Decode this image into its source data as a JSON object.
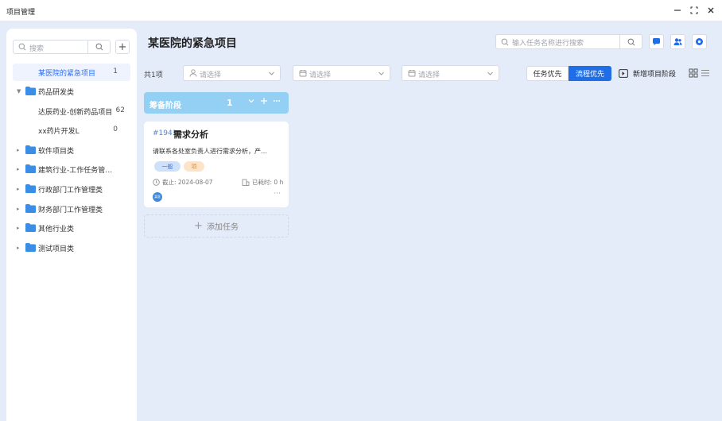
{
  "window": {
    "title": "项目管理",
    "minimize_icon": "minus",
    "maximize_icon": "expand",
    "close_icon": "close"
  },
  "sidebar": {
    "search_placeholder": "搜索",
    "add_label": "+",
    "items": [
      {
        "label": "某医院的紧急项目",
        "count": "1",
        "selected": true,
        "level": 1
      },
      {
        "label": "药品研发类",
        "expanded": true,
        "folder": true
      },
      {
        "label": "达辰药业-创新药品项目",
        "count": "62",
        "level": 1
      },
      {
        "label": "xx药片开发L",
        "count": "0",
        "level": 1
      },
      {
        "label": "软件项目类",
        "folder": true
      },
      {
        "label": "建筑行业-工作任务管…",
        "folder": true
      },
      {
        "label": "行政部门工作管理类",
        "folder": true
      },
      {
        "label": "财务部门工作管理类",
        "folder": true
      },
      {
        "label": "其他行业类",
        "folder": true
      },
      {
        "label": "测试项目类",
        "folder": true
      }
    ]
  },
  "main": {
    "title": "某医院的紧急项目",
    "search_placeholder": "输入任务名称进行搜索",
    "count_label": "共1项",
    "filters": [
      {
        "placeholder": "请选择",
        "icon": "user-icon"
      },
      {
        "placeholder": "请选择",
        "icon": "calendar-icon"
      },
      {
        "placeholder": "请选择",
        "icon": "calendar-icon"
      }
    ],
    "toggle": {
      "task_first": "任务优先",
      "flow_first": "流程优先",
      "active": "flow_first"
    },
    "add_stage_label": "新增项目阶段",
    "accent_color": "#1f6ee8"
  },
  "column": {
    "name": "筹备阶段",
    "count": "1",
    "header_color": "#93d0f3"
  },
  "card": {
    "id": "#1941",
    "title": "需求分析",
    "description": "请联系各处室负责人进行需求分析，产…",
    "tags": [
      "一般",
      "项"
    ],
    "deadline": "截止: 2024-08-07",
    "elapsed": "已耗时: 0 h",
    "avatar_text": "某医",
    "more": "···"
  },
  "add_task_label": "添加任务"
}
